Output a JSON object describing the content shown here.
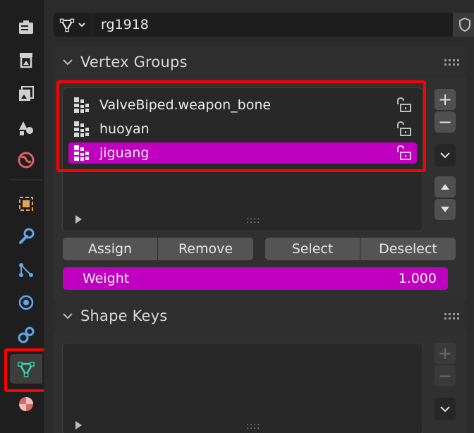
{
  "header": {
    "mesh_name": "rg1918"
  },
  "vertex_groups": {
    "title": "Vertex Groups",
    "items": [
      {
        "label": "ValveBiped.weapon_bone",
        "selected": false
      },
      {
        "label": "huoyan",
        "selected": false
      },
      {
        "label": "jiguang",
        "selected": true
      }
    ],
    "assign_label": "Assign",
    "remove_label": "Remove",
    "select_label": "Select",
    "deselect_label": "Deselect",
    "weight_label": "Weight",
    "weight_value": "1.000"
  },
  "shape_keys": {
    "title": "Shape Keys"
  },
  "grip": "::::",
  "colors": {
    "accent": "#c000c0",
    "highlight": "#ff0000",
    "active_tab_icon": "#3fd8b0"
  },
  "tabs": [
    "tool-icon",
    "render-icon",
    "output-icon",
    "view-layer-icon",
    "scene-icon",
    "world-icon",
    "object-icon",
    "modifier-icon",
    "particles-icon",
    "physics-icon",
    "constraints-icon",
    "mesh-data-icon",
    "material-icon"
  ]
}
